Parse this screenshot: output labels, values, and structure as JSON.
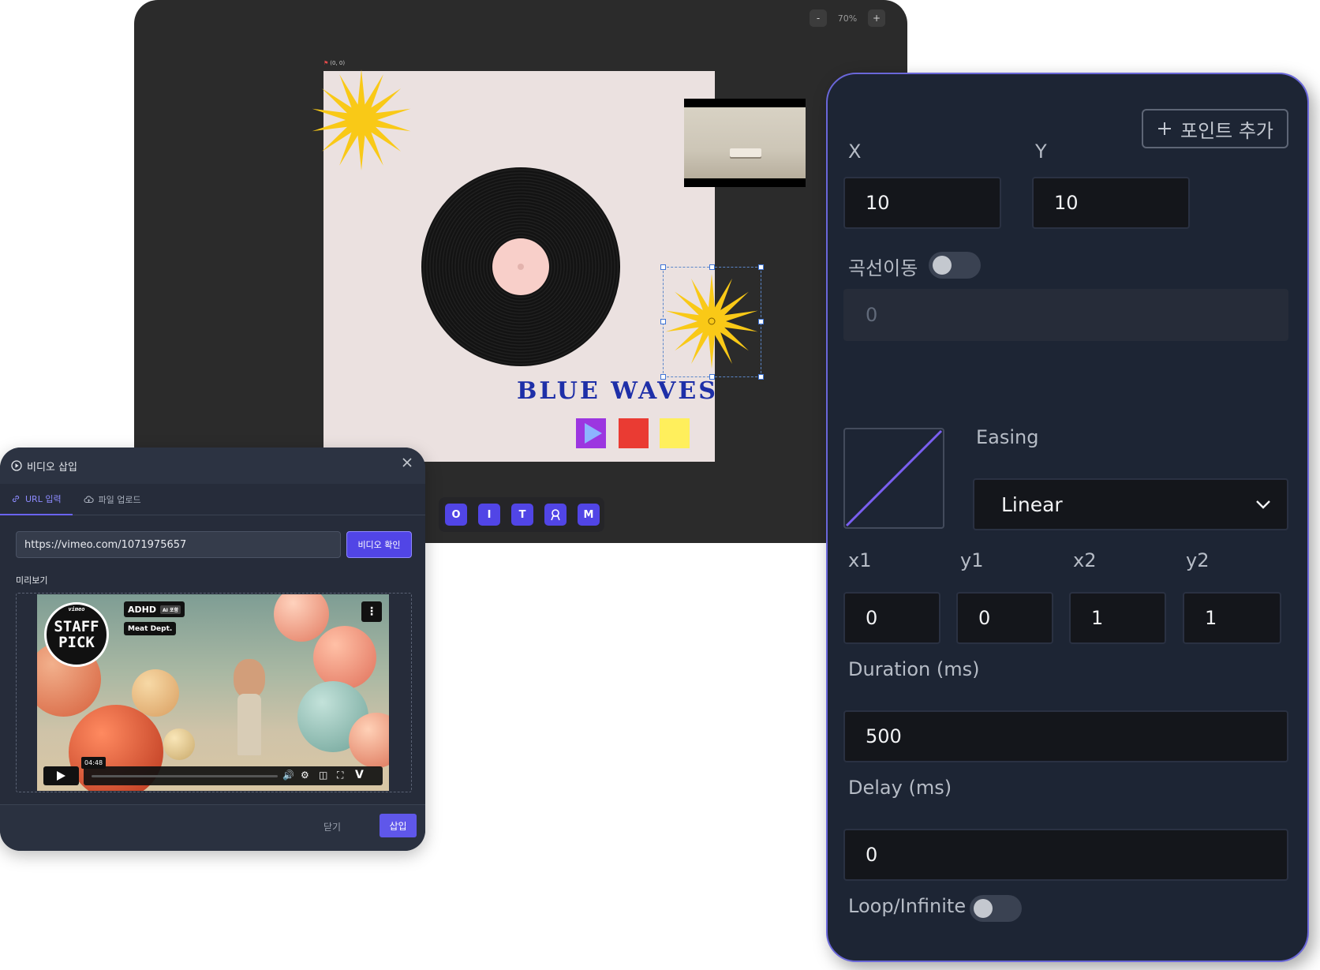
{
  "editor": {
    "zoom": {
      "minus": "-",
      "level": "70%",
      "plus": "+"
    },
    "origin_label": "(0, 0)",
    "canvas_text": "BLUE WAVES",
    "toolbar": [
      "O",
      "I",
      "T",
      "M"
    ]
  },
  "animation_panel": {
    "add_point_label": "포인트 추가",
    "x_label": "X",
    "y_label": "Y",
    "x_value": "10",
    "y_value": "10",
    "curve_label": "곡선이동",
    "curve_enabled": false,
    "curve_value": "0",
    "easing_label": "Easing",
    "easing_value": "Linear",
    "bezier": {
      "x1_label": "x1",
      "y1_label": "y1",
      "x2_label": "x2",
      "y2_label": "y2",
      "x1": "0",
      "y1": "0",
      "x2": "1",
      "y2": "1"
    },
    "duration_label": "Duration (ms)",
    "duration_value": "500",
    "delay_label": "Delay (ms)",
    "delay_value": "0",
    "loop_label": "Loop/Infinite",
    "loop_enabled": false,
    "accent_color": "#6a67d9"
  },
  "video_dialog": {
    "title": "비디오 삽입",
    "tabs": [
      {
        "label": "URL 입력",
        "active": true
      },
      {
        "label": "파일 업로드",
        "active": false
      }
    ],
    "url_value": "https://vimeo.com/1071975657",
    "check_button": "비디오 확인",
    "preview_label": "미리보기",
    "video": {
      "badge_brand": "vimeo",
      "badge_line1": "STAFF",
      "badge_line2": "PICK",
      "title": "ADHD",
      "title_tag": "AI 포함",
      "byline": "Meat Dept.",
      "duration": "04:48"
    },
    "close_button": "닫기",
    "insert_button": "삽입",
    "primary_color": "#5145e6"
  }
}
